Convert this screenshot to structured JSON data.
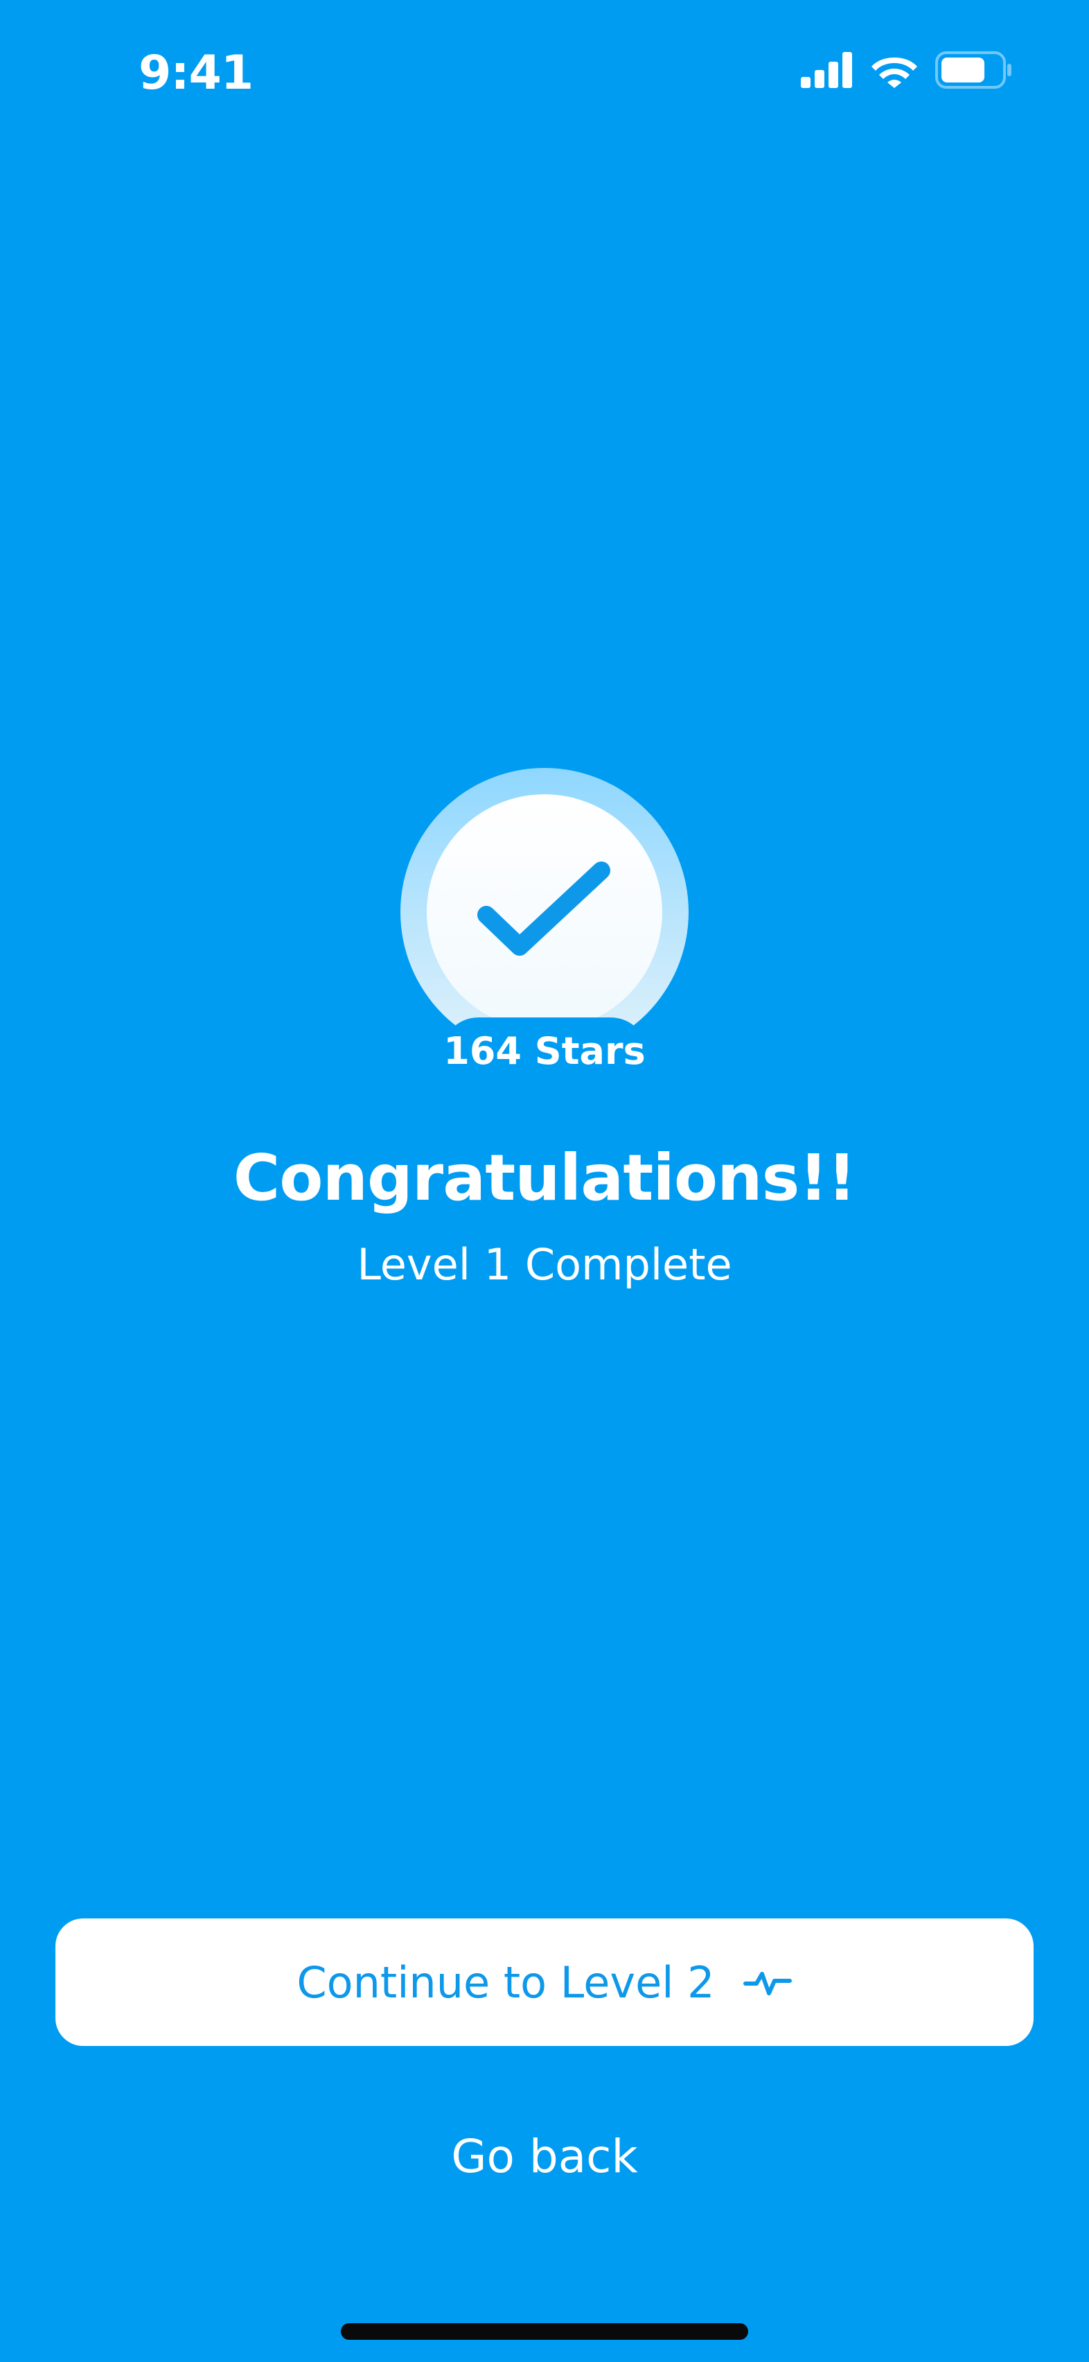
{
  "status_bar": {
    "time": "9:41",
    "icons": [
      "cellular-signal-icon",
      "wifi-icon",
      "battery-icon"
    ]
  },
  "badge": {
    "icon": "checkmark-icon",
    "stars_label": "164 Stars"
  },
  "title": "Congratulations!!",
  "subtitle": "Level 1 Complete",
  "primary_button": {
    "label": "Continue to Level 2",
    "icon": "activity-pulse-icon"
  },
  "secondary_button": {
    "label": "Go back"
  },
  "colors": {
    "background": "#009CF2",
    "primary_button_background": "#FFFFFF",
    "primary_button_text": "#0D98EA",
    "text": "#FFFFFF",
    "home_indicator": "#0A0A0A"
  }
}
